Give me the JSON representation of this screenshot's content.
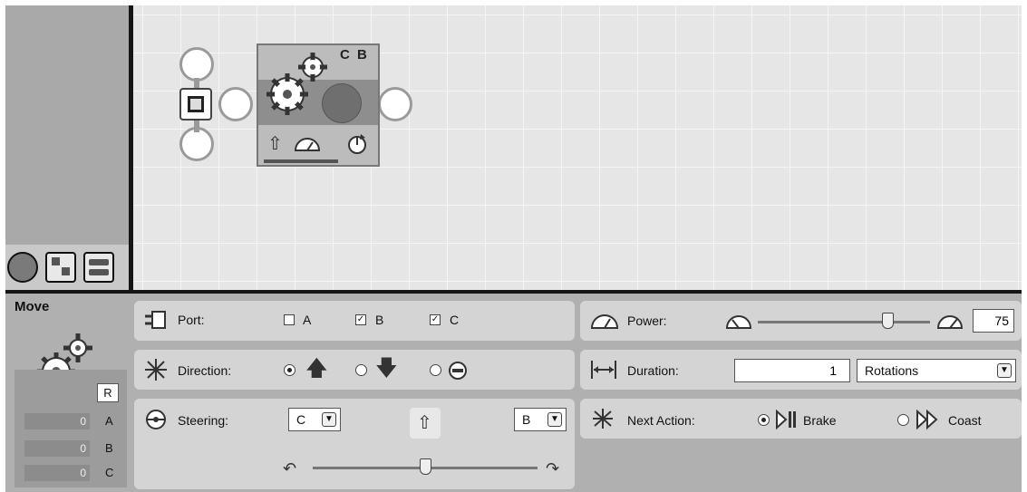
{
  "block": {
    "title": "Move",
    "ports_shown": "C B"
  },
  "feedback": {
    "reset_label": "R",
    "rows": [
      {
        "value": "0",
        "port": "A"
      },
      {
        "value": "0",
        "port": "B"
      },
      {
        "value": "0",
        "port": "C"
      }
    ]
  },
  "port": {
    "label": "Port:",
    "options": [
      {
        "name": "A",
        "checked": false
      },
      {
        "name": "B",
        "checked": true
      },
      {
        "name": "C",
        "checked": true
      }
    ]
  },
  "direction": {
    "label": "Direction:",
    "options": [
      "forward",
      "backward",
      "stop"
    ],
    "selected": "forward"
  },
  "steering": {
    "label": "Steering:",
    "left_port": "C",
    "right_port": "B",
    "position": 0.5
  },
  "power": {
    "label": "Power:",
    "value": "75",
    "level": 0.75
  },
  "duration": {
    "label": "Duration:",
    "value": "1",
    "unit": "Rotations"
  },
  "next_action": {
    "label": "Next Action:",
    "brake_label": "Brake",
    "coast_label": "Coast",
    "selected": "Brake"
  },
  "icons": {
    "block": "gears-icon",
    "power": "speedometer-icon",
    "direction": "up-arrow-icon",
    "rotation": "rotation-icon",
    "port": "port-icon",
    "duration": "duration-icon",
    "next_action": "next-action-icon",
    "steering": "steering-wheel-icon"
  }
}
